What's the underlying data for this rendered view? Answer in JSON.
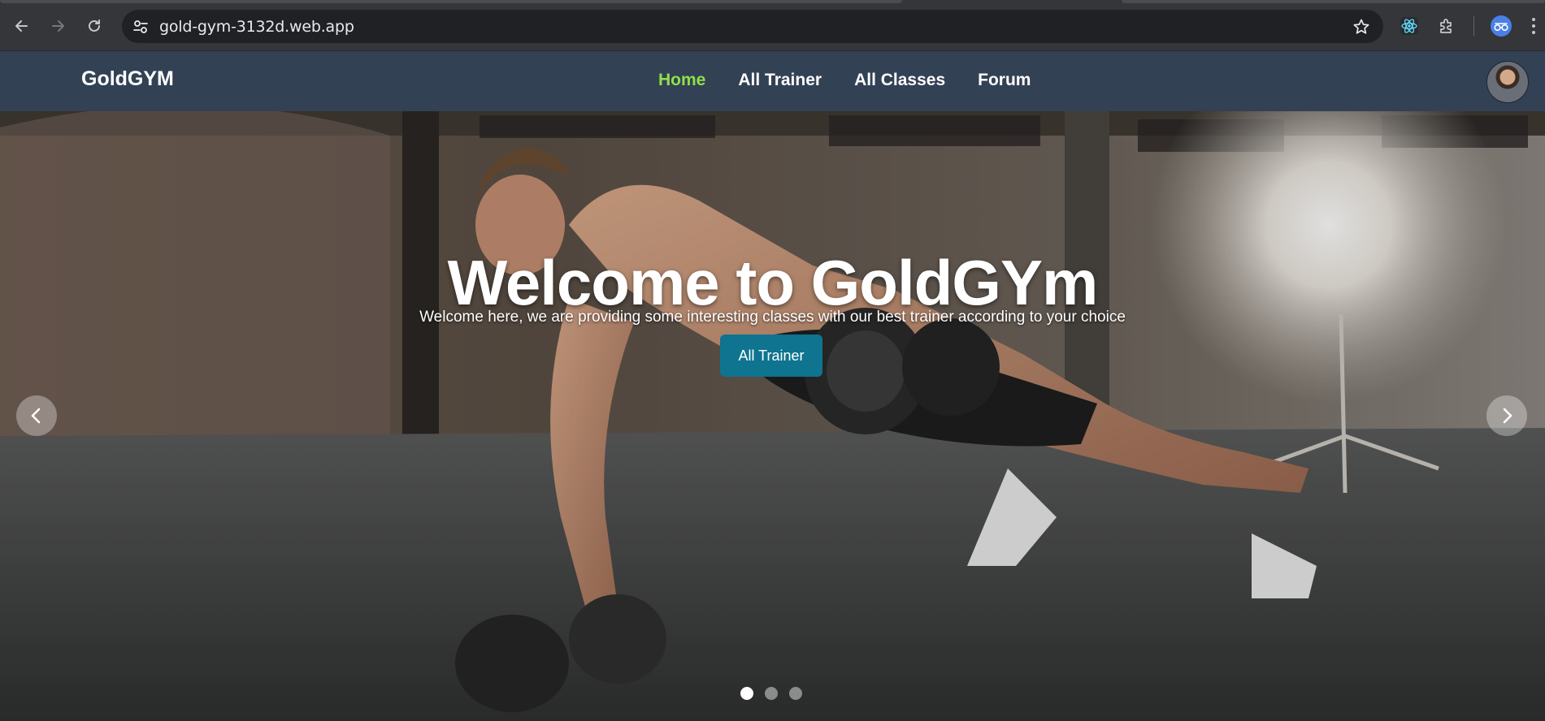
{
  "browser": {
    "url": "gold-gym-3132d.web.app",
    "icons": {
      "back": "arrow-left-icon",
      "forward": "arrow-right-icon",
      "reload": "reload-icon",
      "site_info": "tune-icon",
      "bookmark": "star-icon",
      "react_devtools": "react-icon",
      "extensions": "puzzle-icon",
      "menu": "kebab-menu-icon"
    }
  },
  "navbar": {
    "brand": "GoldGYM",
    "links": [
      {
        "label": "Home",
        "active": true
      },
      {
        "label": "All Trainer",
        "active": false
      },
      {
        "label": "All Classes",
        "active": false
      },
      {
        "label": "Forum",
        "active": false
      }
    ],
    "active_color": "#8fe04a",
    "background": "#334155"
  },
  "hero": {
    "title": "Welcome to GoldGYm",
    "subtitle": "Welcome here, we are providing some interesting classes with our best trainer according to your choice",
    "cta_label": "All Trainer",
    "cta_color": "#0e7490",
    "slides": 3,
    "active_slide": 1
  }
}
